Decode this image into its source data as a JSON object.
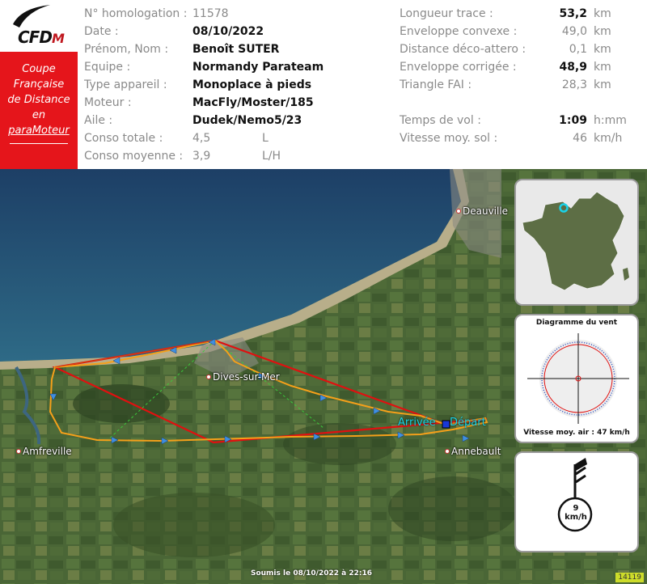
{
  "logo": {
    "text_main": "CFD",
    "text_m": "M"
  },
  "cup": {
    "line1": "Coupe",
    "line2": "Française",
    "line3": "de Distance",
    "line4": "en",
    "line5": "paraMoteur"
  },
  "info_left": [
    {
      "label": "N° homologation :",
      "value": "11578",
      "bold": false
    },
    {
      "label": "Date :",
      "value": "08/10/2022",
      "bold": true
    },
    {
      "label": "Prénom, Nom :",
      "value": "Benoît SUTER",
      "bold": true
    },
    {
      "label": "Equipe :",
      "value": "Normandy Parateam",
      "bold": true
    },
    {
      "label": "Type appareil :",
      "value": "Monoplace à pieds",
      "bold": true
    },
    {
      "label": "Moteur :",
      "value": "MacFly/Moster/185",
      "bold": true
    },
    {
      "label": "Aile :",
      "value": "Dudek/Nemo5/23",
      "bold": true
    },
    {
      "label": "Conso totale :",
      "value": "4,5",
      "unit": "L",
      "bold": false
    },
    {
      "label": "Conso moyenne :",
      "value": "3,9",
      "unit": "L/H",
      "bold": false
    }
  ],
  "info_right": [
    {
      "label": "Longueur trace :",
      "value": "53,2",
      "unit": "km",
      "bold": true
    },
    {
      "label": "Enveloppe convexe :",
      "value": "49,0",
      "unit": "km",
      "bold": false
    },
    {
      "label": "Distance déco-attero :",
      "value": "0,1",
      "unit": "km",
      "bold": false
    },
    {
      "label": "Enveloppe corrigée :",
      "value": "48,9",
      "unit": "km",
      "bold": true
    },
    {
      "label": "Triangle FAI :",
      "value": "28,3",
      "unit": "km",
      "bold": false
    },
    {
      "label": "Temps de vol :",
      "value": "1:09",
      "unit": "h:mm",
      "bold": true
    },
    {
      "label": "Vitesse moy. sol :",
      "value": "46",
      "unit": "km/h",
      "bold": false
    }
  ],
  "map": {
    "places": {
      "deauville": "Deauville",
      "dives": "Dives-sur-Mer",
      "amfreville": "Amfreville",
      "annebault": "Annebault"
    },
    "arrivee": "Arrivée",
    "depart": "Départ",
    "wind_title": "Diagramme du vent",
    "wind_foot": "Vitesse moy. air : 47 km/h",
    "wind_speed_value": "9",
    "wind_speed_unit": "km/h",
    "submitted": "Soumis le 08/10/2022 à 22:16",
    "badge": "14119"
  },
  "colors": {
    "cup_red": "#e5151b",
    "track_red": "#e01010",
    "track_orange": "#f5a01a",
    "cyan": "#19d2e8"
  }
}
